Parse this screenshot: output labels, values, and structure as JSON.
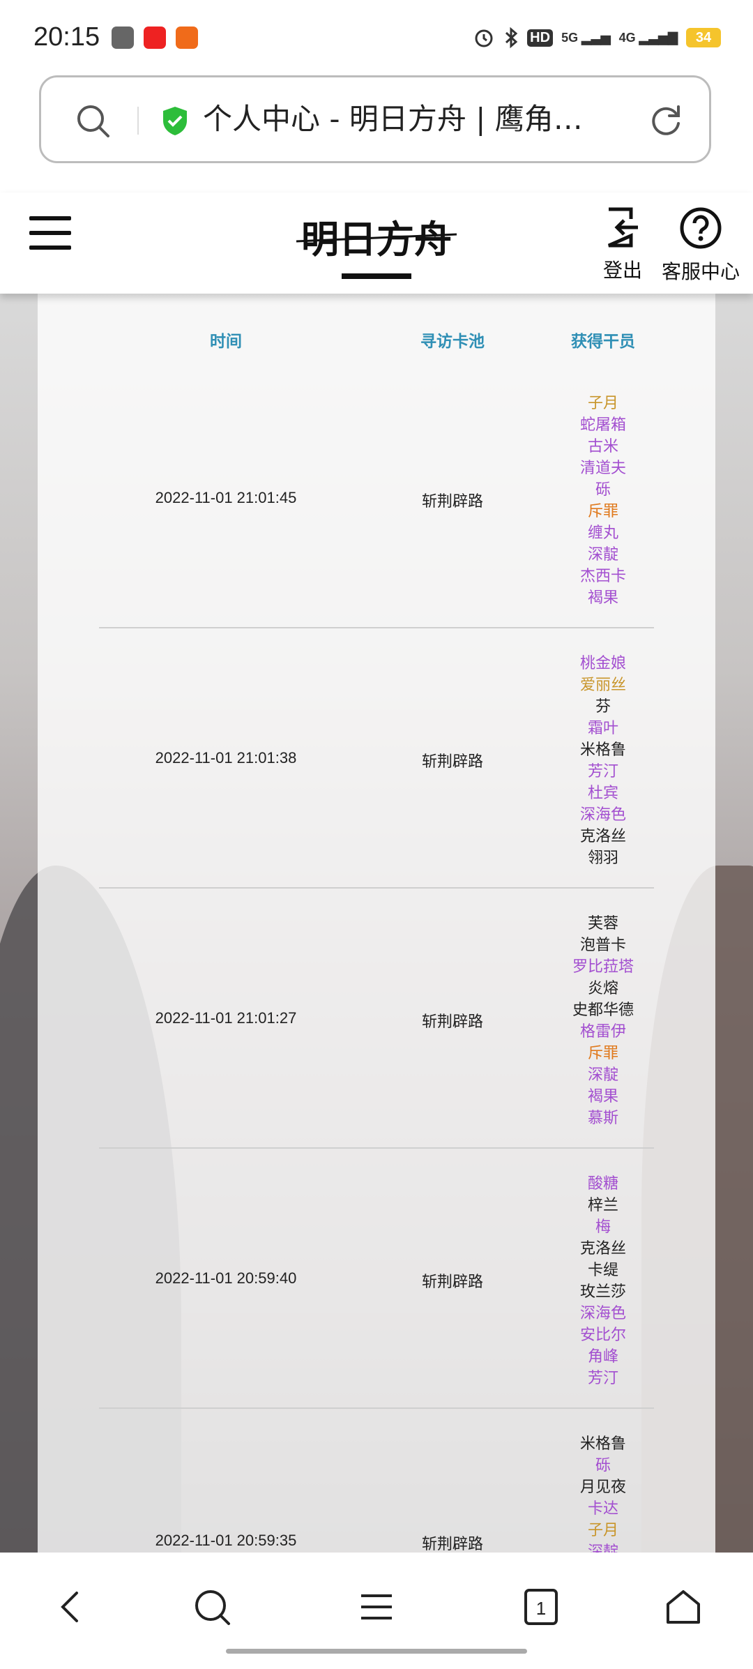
{
  "status_bar": {
    "time": "20:15",
    "hd_label": "HD",
    "sim1_label": "5G",
    "sim2_label": "4G",
    "battery": "34"
  },
  "address_bar": {
    "title": "个人中心 - 明日方舟 | 鹰角…"
  },
  "header": {
    "logo_text": "明日方舟",
    "logout_label": "登出",
    "help_label": "客服中心"
  },
  "table": {
    "headers": {
      "time": "时间",
      "pool": "寻访卡池",
      "operators": "获得干员"
    },
    "colors": {
      "six_star": "#e07a1e",
      "five_star": "#c8952a",
      "four_star": "#a34fd0",
      "three_star": "#222222"
    },
    "rows": [
      {
        "time": "2022-11-01 21:01:45",
        "pool": "斩荆辟路",
        "operators": [
          {
            "name": "子月",
            "rarity": "five_star"
          },
          {
            "name": "蛇屠箱",
            "rarity": "four_star"
          },
          {
            "name": "古米",
            "rarity": "four_star"
          },
          {
            "name": "清道夫",
            "rarity": "four_star"
          },
          {
            "name": "砾",
            "rarity": "four_star"
          },
          {
            "name": "斥罪",
            "rarity": "six_star"
          },
          {
            "name": "缠丸",
            "rarity": "four_star"
          },
          {
            "name": "深靛",
            "rarity": "four_star"
          },
          {
            "name": "杰西卡",
            "rarity": "four_star"
          },
          {
            "name": "褐果",
            "rarity": "four_star"
          }
        ]
      },
      {
        "time": "2022-11-01 21:01:38",
        "pool": "斩荆辟路",
        "operators": [
          {
            "name": "桃金娘",
            "rarity": "four_star"
          },
          {
            "name": "爱丽丝",
            "rarity": "five_star"
          },
          {
            "name": "芬",
            "rarity": "three_star"
          },
          {
            "name": "霜叶",
            "rarity": "four_star"
          },
          {
            "name": "米格鲁",
            "rarity": "three_star"
          },
          {
            "name": "芳汀",
            "rarity": "four_star"
          },
          {
            "name": "杜宾",
            "rarity": "four_star"
          },
          {
            "name": "深海色",
            "rarity": "four_star"
          },
          {
            "name": "克洛丝",
            "rarity": "three_star"
          },
          {
            "name": "翎羽",
            "rarity": "three_star"
          }
        ]
      },
      {
        "time": "2022-11-01 21:01:27",
        "pool": "斩荆辟路",
        "operators": [
          {
            "name": "芙蓉",
            "rarity": "three_star"
          },
          {
            "name": "泡普卡",
            "rarity": "three_star"
          },
          {
            "name": "罗比菈塔",
            "rarity": "four_star"
          },
          {
            "name": "炎熔",
            "rarity": "three_star"
          },
          {
            "name": "史都华德",
            "rarity": "three_star"
          },
          {
            "name": "格雷伊",
            "rarity": "four_star"
          },
          {
            "name": "斥罪",
            "rarity": "six_star"
          },
          {
            "name": "深靛",
            "rarity": "four_star"
          },
          {
            "name": "褐果",
            "rarity": "four_star"
          },
          {
            "name": "慕斯",
            "rarity": "four_star"
          }
        ]
      },
      {
        "time": "2022-11-01 20:59:40",
        "pool": "斩荆辟路",
        "operators": [
          {
            "name": "酸糖",
            "rarity": "four_star"
          },
          {
            "name": "梓兰",
            "rarity": "three_star"
          },
          {
            "name": "梅",
            "rarity": "four_star"
          },
          {
            "name": "克洛丝",
            "rarity": "three_star"
          },
          {
            "name": "卡缇",
            "rarity": "three_star"
          },
          {
            "name": "玫兰莎",
            "rarity": "three_star"
          },
          {
            "name": "深海色",
            "rarity": "four_star"
          },
          {
            "name": "安比尔",
            "rarity": "four_star"
          },
          {
            "name": "角峰",
            "rarity": "four_star"
          },
          {
            "name": "芳汀",
            "rarity": "four_star"
          }
        ]
      },
      {
        "time": "2022-11-01 20:59:35",
        "pool": "斩荆辟路",
        "operators": [
          {
            "name": "米格鲁",
            "rarity": "three_star"
          },
          {
            "name": "砾",
            "rarity": "four_star"
          },
          {
            "name": "月见夜",
            "rarity": "three_star"
          },
          {
            "name": "卡达",
            "rarity": "four_star"
          },
          {
            "name": "子月",
            "rarity": "five_star"
          },
          {
            "name": "深靛",
            "rarity": "four_star"
          }
        ]
      }
    ]
  }
}
